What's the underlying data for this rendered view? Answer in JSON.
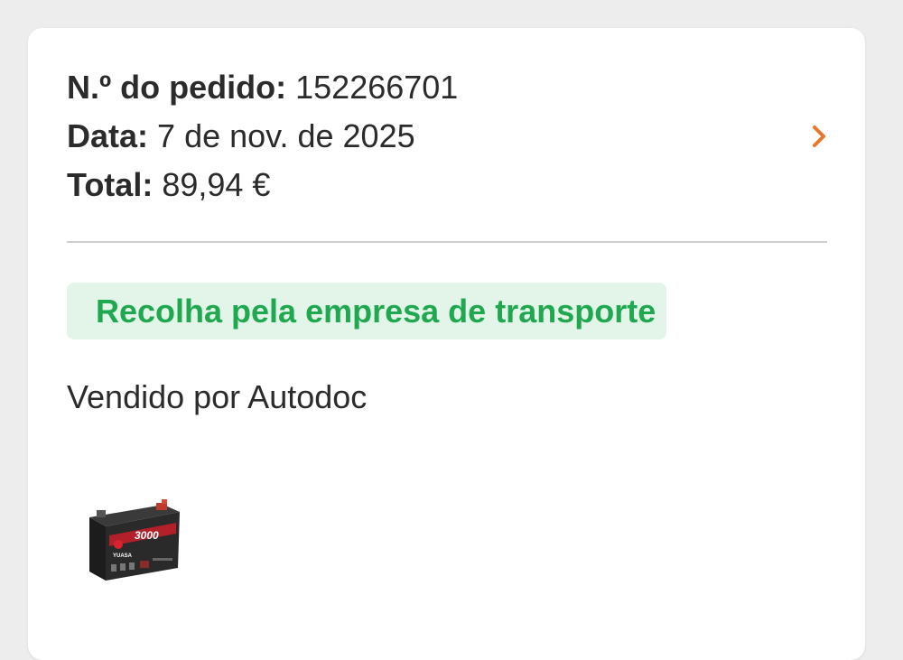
{
  "order": {
    "number_label": "N.º do pedido:",
    "number_value": "152266701",
    "date_label": "Data:",
    "date_value": "7 de nov. de 2025",
    "total_label": "Total:",
    "total_value": "89,94 €"
  },
  "status": {
    "text": "Recolha pela empresa de transporte",
    "text_color": "#1fa84f",
    "background": "#e3f5e9"
  },
  "seller": {
    "text": "Vendido por Autodoc"
  },
  "product": {
    "image_name": "car-battery-image",
    "logo_text": "YUASA",
    "model_text": "3000"
  },
  "icons": {
    "open_details": "chevron-right-icon"
  },
  "colors": {
    "accent": "#e8772e",
    "page_background": "#ededed",
    "card_background": "#ffffff"
  }
}
